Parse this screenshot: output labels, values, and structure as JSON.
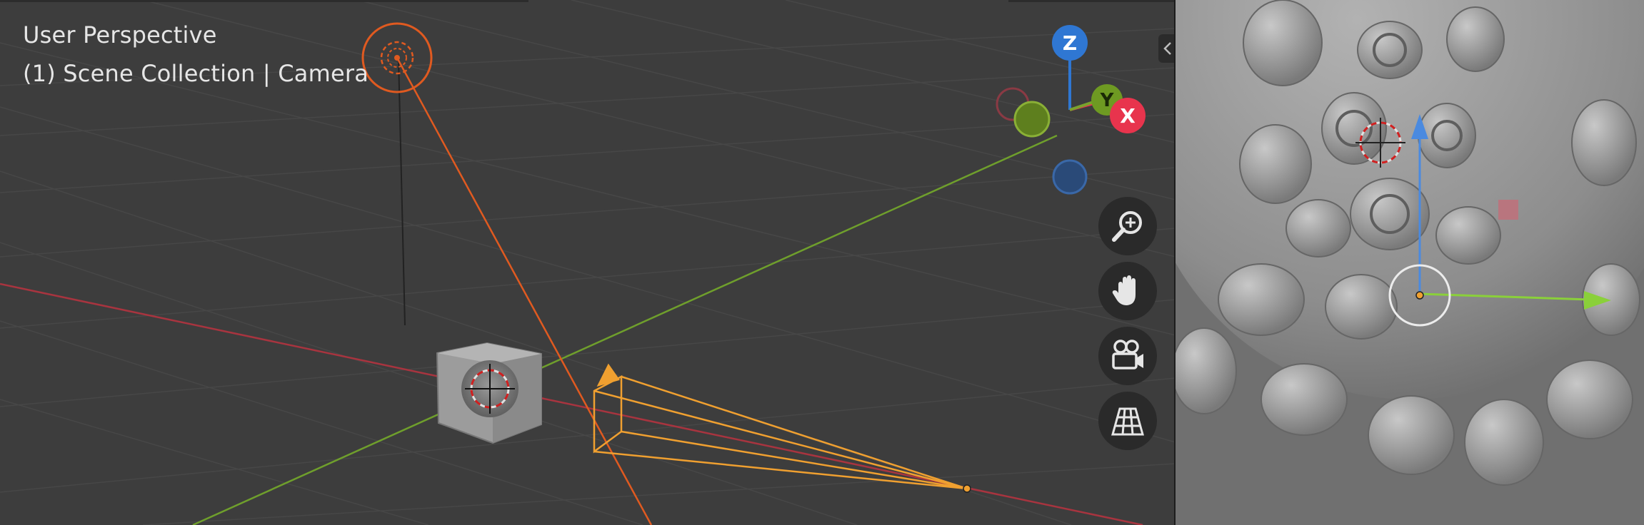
{
  "viewport": {
    "view_label": "User Perspective",
    "context_label": "(1) Scene Collection | Camera"
  },
  "gizmo": {
    "z_label": "Z",
    "y_label": "Y",
    "x_label": "X",
    "colors": {
      "x": "#e8344d",
      "y": "#7aa12d",
      "z": "#2f77d3"
    }
  },
  "nav": [
    {
      "name": "zoom-icon"
    },
    {
      "name": "hand-pan-icon"
    },
    {
      "name": "camera-view-icon"
    },
    {
      "name": "perspective-grid-icon"
    }
  ],
  "colors": {
    "viewport_bg": "#3d3d3d",
    "grid_line": "#474747",
    "x_axis": "#a8343f",
    "y_axis": "#6f9f2c",
    "selection": "#f0a030",
    "light": "#e05a20"
  }
}
